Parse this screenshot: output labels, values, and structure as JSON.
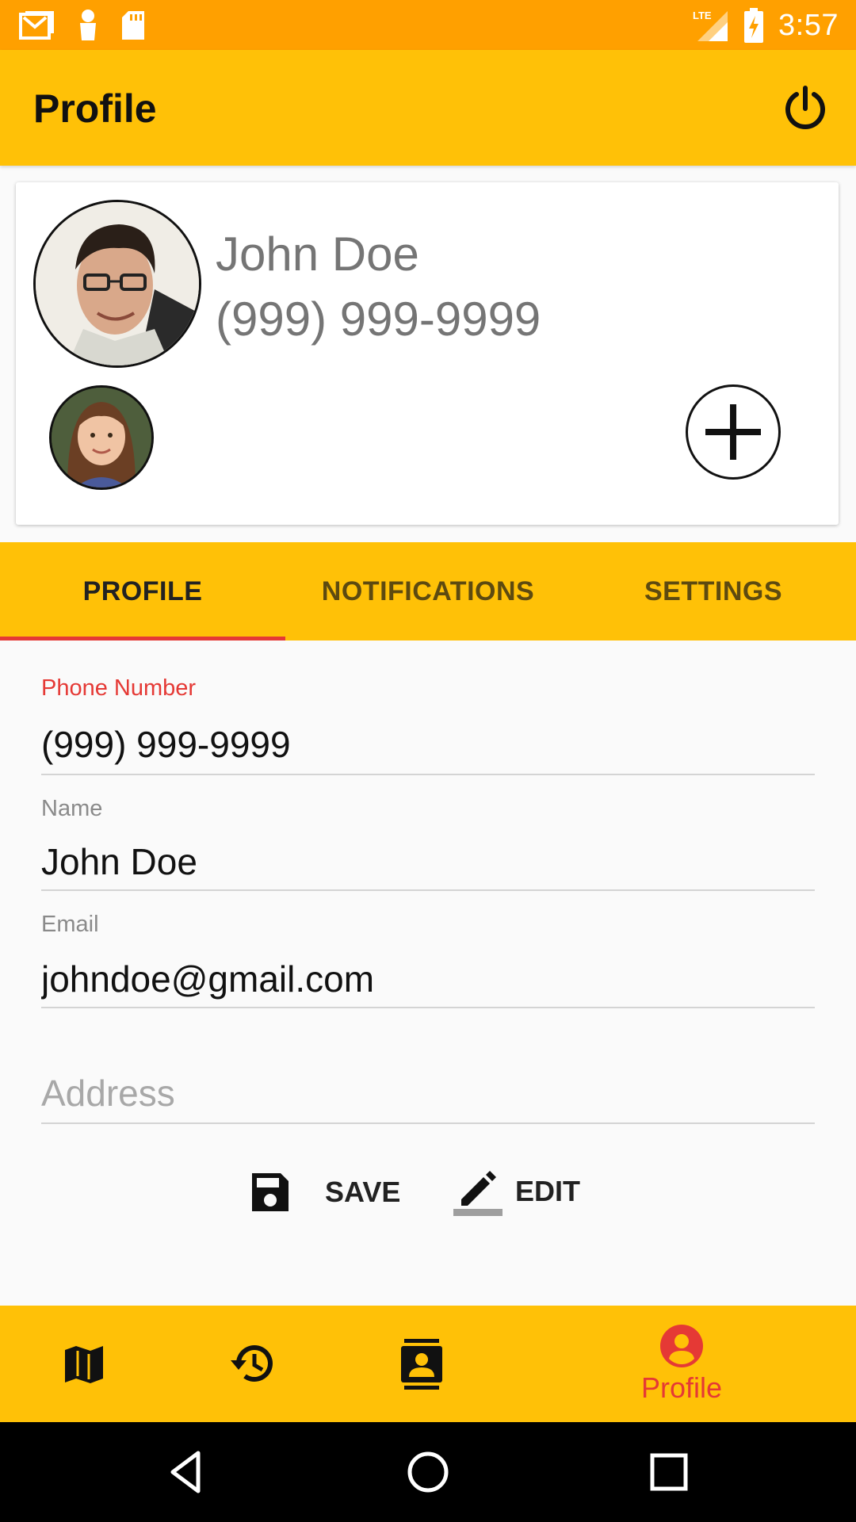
{
  "status_bar": {
    "time": "3:57",
    "network_label": "LTE",
    "icons": [
      "gmail-icon",
      "person-notification-icon",
      "sd-card-icon",
      "lte-signal-icon",
      "battery-charging-icon"
    ]
  },
  "app_bar": {
    "title": "Profile",
    "power_icon": "power-icon"
  },
  "profile_card": {
    "name": "John Doe",
    "phone": "(999) 999-9999",
    "add_icon": "plus-icon"
  },
  "tabs": [
    {
      "label": "PROFILE",
      "active": true
    },
    {
      "label": "NOTIFICATIONS",
      "active": false
    },
    {
      "label": "SETTINGS",
      "active": false
    }
  ],
  "form": {
    "phone": {
      "label": "Phone Number",
      "value": "(999) 999-9999"
    },
    "name": {
      "label": "Name",
      "value": "John Doe"
    },
    "email": {
      "label": "Email",
      "value": "johndoe@gmail.com"
    },
    "address": {
      "placeholder": "Address",
      "value": ""
    }
  },
  "actions": {
    "save_label": "SAVE",
    "edit_label": "EDIT"
  },
  "bottom_nav": {
    "items": [
      {
        "icon": "map-icon",
        "label": ""
      },
      {
        "icon": "history-icon",
        "label": ""
      },
      {
        "icon": "contacts-icon",
        "label": ""
      },
      {
        "icon": "account-circle-icon",
        "label": "Profile",
        "active": true
      }
    ]
  },
  "colors": {
    "status_bar": "#FFA000",
    "primary": "#FFC107",
    "accent": "#E53935",
    "secondary_text": "#757575"
  }
}
